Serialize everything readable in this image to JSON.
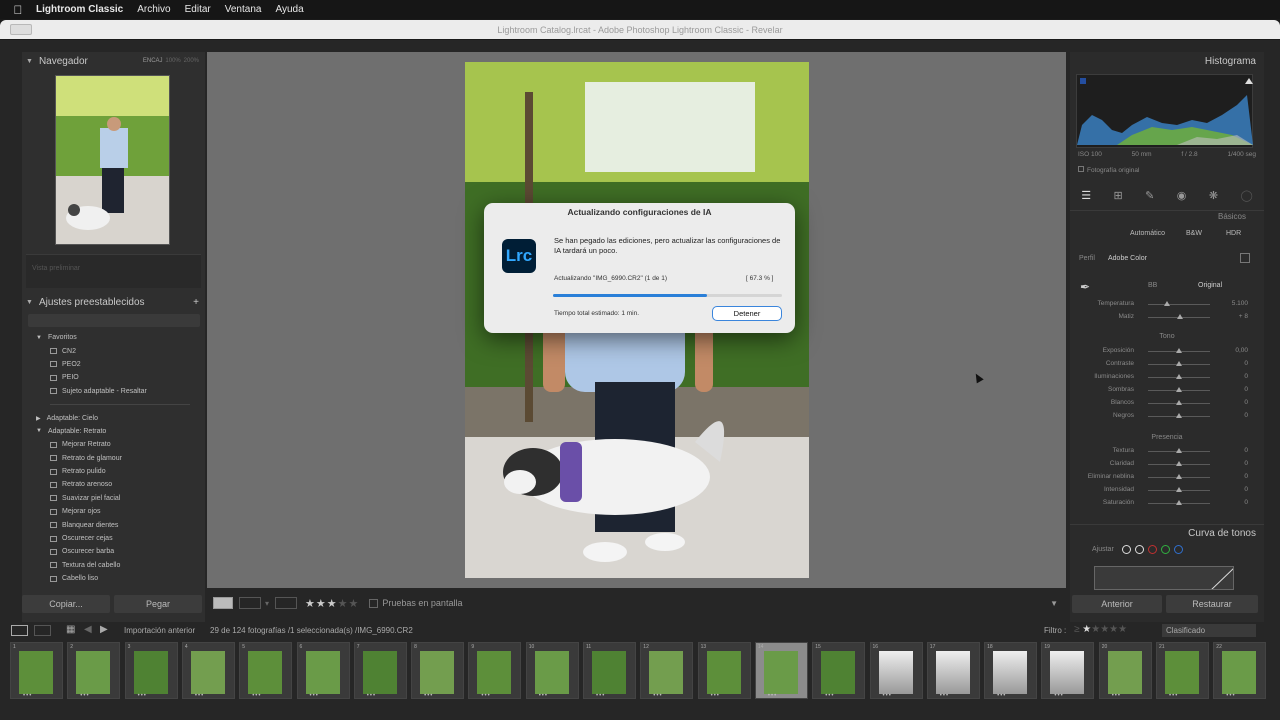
{
  "menubar": {
    "app": "Lightroom Classic",
    "items": [
      "Archivo",
      "Editar",
      "Ventana",
      "Ayuda"
    ]
  },
  "window": {
    "title": "Lightroom Catalog.lrcat - Adobe Photoshop Lightroom Classic - Revelar"
  },
  "left": {
    "navigator": {
      "title": "Navegador",
      "zoom": [
        "ENCAJ",
        "100%",
        "200%"
      ]
    },
    "snapshot_label": "Vista preliminar",
    "presets": {
      "title": "Ajustes preestablecidos",
      "groups": [
        {
          "name": "Favoritos",
          "items": [
            "CN2",
            "PEO2",
            "PEIO",
            "Sujeto adaptable - Resaltar"
          ]
        },
        {
          "name": "Adaptable: Cielo",
          "items": []
        },
        {
          "name": "Adaptable: Retrato",
          "items": [
            "Mejorar Retrato",
            "Retrato de glamour",
            "Retrato pulido",
            "Retrato arenoso",
            "Suavizar piel facial",
            "Mejorar ojos",
            "Blanquear dientes",
            "Oscurecer cejas",
            "Oscurecer barba",
            "Textura del cabello",
            "Cabello liso"
          ]
        }
      ]
    },
    "copy_button": "Copiar...",
    "paste_button": "Pegar"
  },
  "toolbar": {
    "rating_stars": 3,
    "softproof_label": "Pruebas en pantalla"
  },
  "dialog": {
    "title": "Actualizando configuraciones de IA",
    "icon": "Lrc",
    "message": "Se han pegado las ediciones, pero actualizar las configuraciones de IA tardará un poco.",
    "progress_text": "Actualizando \"IMG_6990.CR2\" (1 de 1)",
    "percent_text": "[ 67.3 % ]",
    "progress": 0.673,
    "estimate": "Tiempo total estimado: 1 min.",
    "stop_button": "Detener"
  },
  "right": {
    "histogram": {
      "title": "Histograma",
      "info": [
        "ISO 100",
        "50 mm",
        "f / 2.8",
        "1/400 seg"
      ],
      "original_photo": "Fotografía original"
    },
    "basic": {
      "title": "Básicos",
      "treatment": [
        "Automático",
        "B&W",
        "HDR"
      ],
      "profile_label": "Perfil",
      "profile_value": "Adobe Color",
      "wb_label": "BB",
      "wb_value": "Original",
      "sliders_wb": [
        {
          "label": "Temperatura",
          "value": "5.100",
          "pos": 0.3
        },
        {
          "label": "Matiz",
          "value": "+ 8",
          "pos": 0.52
        }
      ],
      "tone_label": "Tono",
      "sliders_tone": [
        {
          "label": "Exposición",
          "value": "0,00",
          "pos": 0.5
        },
        {
          "label": "Contraste",
          "value": "0",
          "pos": 0.5
        },
        {
          "label": "Iluminaciones",
          "value": "0",
          "pos": 0.5
        },
        {
          "label": "Sombras",
          "value": "0",
          "pos": 0.5
        },
        {
          "label": "Blancos",
          "value": "0",
          "pos": 0.5
        },
        {
          "label": "Negros",
          "value": "0",
          "pos": 0.5
        }
      ],
      "presence_label": "Presencia",
      "sliders_presence": [
        {
          "label": "Textura",
          "value": "0",
          "pos": 0.5
        },
        {
          "label": "Claridad",
          "value": "0",
          "pos": 0.5
        },
        {
          "label": "Eliminar neblina",
          "value": "0",
          "pos": 0.5
        },
        {
          "label": "Intensidad",
          "value": "0",
          "pos": 0.5
        },
        {
          "label": "Saturación",
          "value": "0",
          "pos": 0.5
        }
      ]
    },
    "tone_curve": {
      "title": "Curva de tonos",
      "adjust_label": "Ajustar"
    },
    "previous_button": "Anterior",
    "reset_button": "Restaurar"
  },
  "filmstrip": {
    "source": "Importación anterior",
    "info": "29 de 124 fotografías /1 seleccionada(s) /IMG_6990.CR2",
    "filter_label": "Filtro :",
    "filter_value": "Clasificado",
    "frames": [
      "1",
      "2",
      "3",
      "4",
      "5",
      "6",
      "7",
      "8",
      "9",
      "10",
      "11",
      "12",
      "13",
      "14",
      "15",
      "16",
      "17",
      "18",
      "19",
      "20",
      "21",
      "22"
    ]
  }
}
